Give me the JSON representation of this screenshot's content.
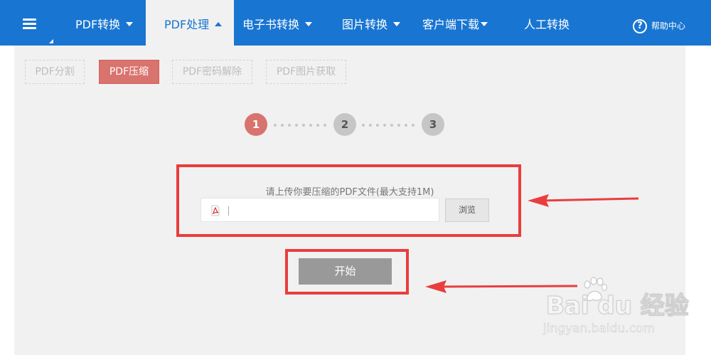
{
  "nav": {
    "items": [
      {
        "label": "PDF转换",
        "caret": "down"
      },
      {
        "label": "PDF处理",
        "caret": "up",
        "active": true
      },
      {
        "label": "电子书转换",
        "caret": "down"
      },
      {
        "label": "图片转换",
        "caret": "down"
      },
      {
        "label": "客户端下载",
        "caret": "down"
      },
      {
        "label": "人工转换",
        "caret": ""
      }
    ],
    "help_icon": "?",
    "help_label": "帮助中心",
    "accent_color": "#1875d2"
  },
  "subtabs": [
    {
      "label": "PDF分割",
      "active": false
    },
    {
      "label": "PDF压缩",
      "active": true
    },
    {
      "label": "PDF密码解除",
      "active": false
    },
    {
      "label": "PDF图片获取",
      "active": false
    }
  ],
  "steps": [
    "1",
    "2",
    "3"
  ],
  "current_step": 1,
  "upload": {
    "hint": "请上传你要压缩的PDF文件(最大支持1M)",
    "file_value": "",
    "browse_label": "浏览"
  },
  "start_label": "开始",
  "watermark": {
    "logo": "Bai du 经验",
    "url": "jingyan.baidu.com"
  },
  "colors": {
    "annotation": "#ea3d3e",
    "active_tab": "#d9736e",
    "start_button": "#999999",
    "panel": "#f1f1f1"
  }
}
